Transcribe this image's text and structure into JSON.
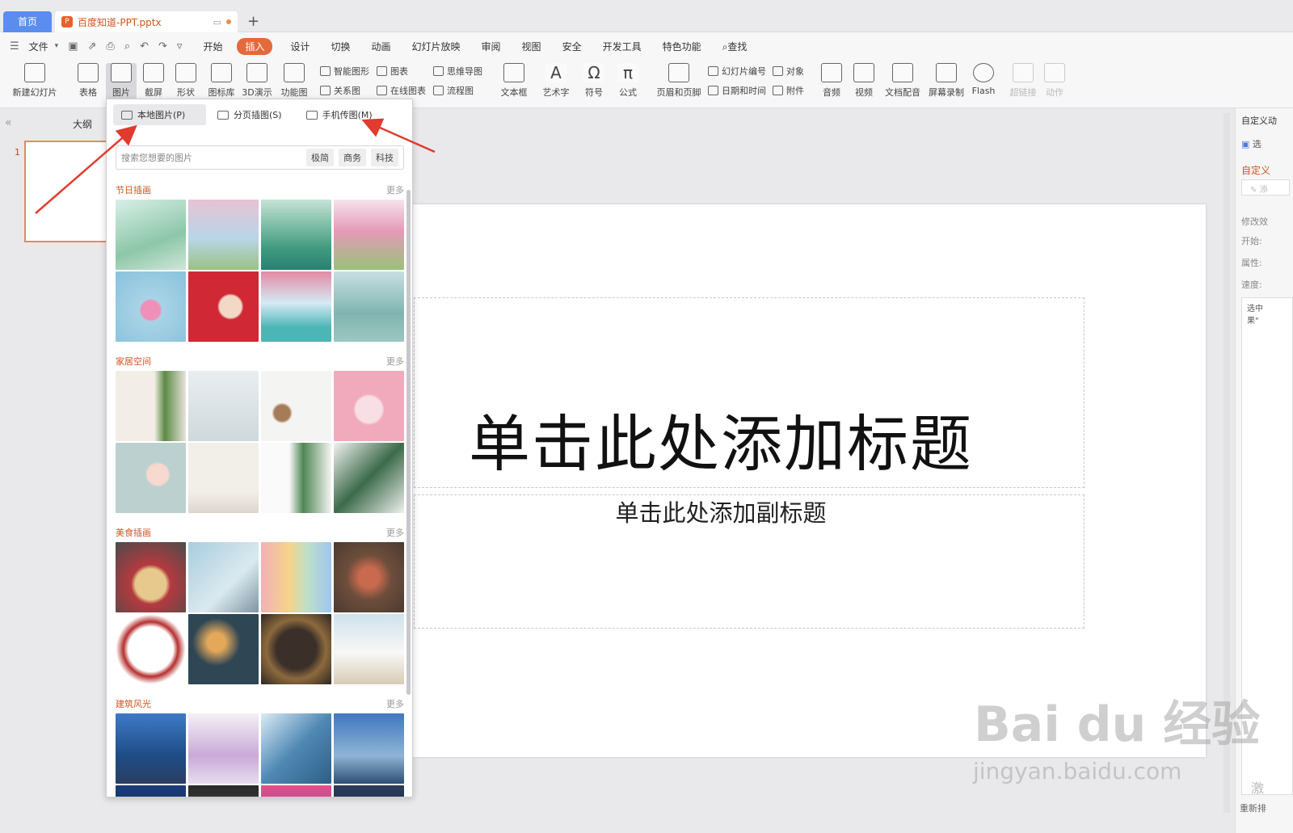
{
  "tabs": {
    "home": "首页",
    "doc": "百度知道-PPT.pptx"
  },
  "menu": {
    "file": "文件",
    "items": [
      "开始",
      "插入",
      "设计",
      "切换",
      "动画",
      "幻灯片放映",
      "审阅",
      "视图",
      "安全",
      "开发工具",
      "特色功能"
    ],
    "search": "查找",
    "active": "插入"
  },
  "ribbon": {
    "new_slide": "新建幻灯片",
    "table": "表格",
    "picture": "图片",
    "screenshot": "截屏",
    "shape": "形状",
    "icons": "图标库",
    "demo3d": "3D演示",
    "function_chart": "功能图",
    "smart_shape": "智能图形",
    "chart": "图表",
    "mind_map": "思维导图",
    "relation": "关系图",
    "online_chart": "在线图表",
    "flowchart": "流程图",
    "textbox": "文本框",
    "art_text": "艺术字",
    "symbol": "符号",
    "formula": "公式",
    "header_footer": "页眉和页脚",
    "slide_number": "幻灯片编号",
    "object": "对象",
    "date_time": "日期和时间",
    "attachment": "附件",
    "audio": "音频",
    "video": "视频",
    "doc_voice": "文档配音",
    "screen_record": "屏幕录制",
    "flash": "Flash",
    "hyperlink": "超链接",
    "action": "动作"
  },
  "left": {
    "outline": "大纲",
    "slide_number": "1"
  },
  "popup": {
    "tab_local": "本地图片(P)",
    "tab_paged": "分页插图(S)",
    "tab_phone": "手机传图(M)",
    "search_placeholder": "搜索您想要的图片",
    "tags": [
      "极简",
      "商务",
      "科技"
    ],
    "more": "更多",
    "sections": [
      "节日插画",
      "家居空间",
      "美食插画",
      "建筑风光"
    ]
  },
  "slide": {
    "title": "单击此处添加标题",
    "subtitle": "单击此处添加副标题"
  },
  "right": {
    "title": "自定义动",
    "select": "选",
    "custom": "自定义",
    "add": "添",
    "modify": "修改效",
    "start": "开始:",
    "property": "属性:",
    "speed": "速度:",
    "note": "选中\n果\"",
    "activate": "激",
    "reorder": "重新排"
  },
  "watermark": {
    "brand": "Bai du 经验",
    "url": "jingyan.baidu.com"
  },
  "colors": {
    "accent": "#d2541f",
    "home_tab": "#5b8def",
    "arrow": "#e03b2e"
  }
}
